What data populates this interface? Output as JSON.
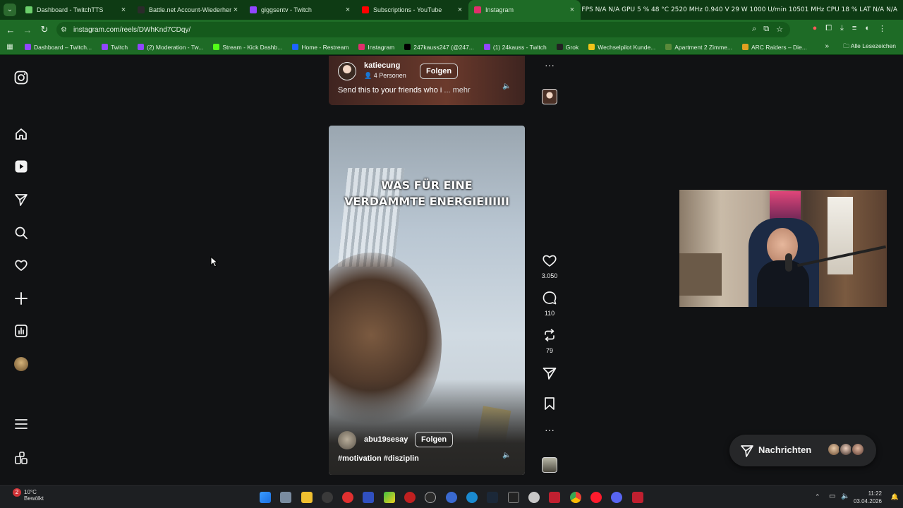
{
  "browser": {
    "tabs": [
      {
        "title": "Dashboard - TwitchTTS",
        "color": "#6bcf6b"
      },
      {
        "title": "Battle.net Account-Wiederherst",
        "color": "#2b2b2b"
      },
      {
        "title": "giggsentv - Twitch",
        "color": "#9146ff"
      },
      {
        "title": "Subscriptions - YouTube",
        "color": "#ff0000"
      },
      {
        "title": "Instagram",
        "color": "#e1306c",
        "active": true
      }
    ],
    "hw_overlay": "FPS N/A N/A  GPU  5 %  48 °C 2520 MHz 0.940 V 29 W 1000 U/min 10501 MHz  CPU 18 %  LAT N/A N/A",
    "url": "instagram.com/reels/DWhKnd7CDqy/",
    "bookmarks": [
      {
        "label": "Dashboard – Twitch...",
        "color": "#9146ff"
      },
      {
        "label": "Twitch",
        "color": "#9146ff"
      },
      {
        "label": "(2) Moderation - Tw...",
        "color": "#9146ff"
      },
      {
        "label": "Stream - Kick Dashb...",
        "color": "#53fc18"
      },
      {
        "label": "Home - Restream",
        "color": "#1e64ff"
      },
      {
        "label": "Instagram",
        "color": "#e1306c"
      },
      {
        "label": "247kauss247 (@247...",
        "color": "#000000"
      },
      {
        "label": "(1) 24kauss - Twitch",
        "color": "#9146ff"
      },
      {
        "label": "Grok",
        "color": "#222222"
      },
      {
        "label": "Wechselpilot Kunde...",
        "color": "#f0c419"
      },
      {
        "label": "Apartment 2 Zimme...",
        "color": "#5a8a3a"
      },
      {
        "label": "ARC Raiders – Die...",
        "color": "#e0a020"
      }
    ],
    "bookmarks_more": "»",
    "all_bookmarks": "Alle Lesezeichen"
  },
  "instagram": {
    "top_reel": {
      "username": "katiecung",
      "sub": "4 Personen",
      "follow_label": "Folgen",
      "caption": "Send this to your friends who i",
      "more": "... mehr"
    },
    "main_reel": {
      "overlay_text_line1": "WAS FÜR EINE",
      "overlay_text_line2": "VERDAMMTE ENERGIEIIIIII",
      "username": "abu19sesay",
      "follow_label": "Folgen",
      "caption": "#motivation #disziplin"
    },
    "actions": {
      "likes": "3.050",
      "comments": "110",
      "reposts": "79"
    },
    "messages_label": "Nachrichten"
  },
  "taskbar": {
    "badge": "2",
    "temperature": "10°C",
    "condition": "Bewölkt",
    "time": "11:22",
    "date": "03.04.2026"
  }
}
